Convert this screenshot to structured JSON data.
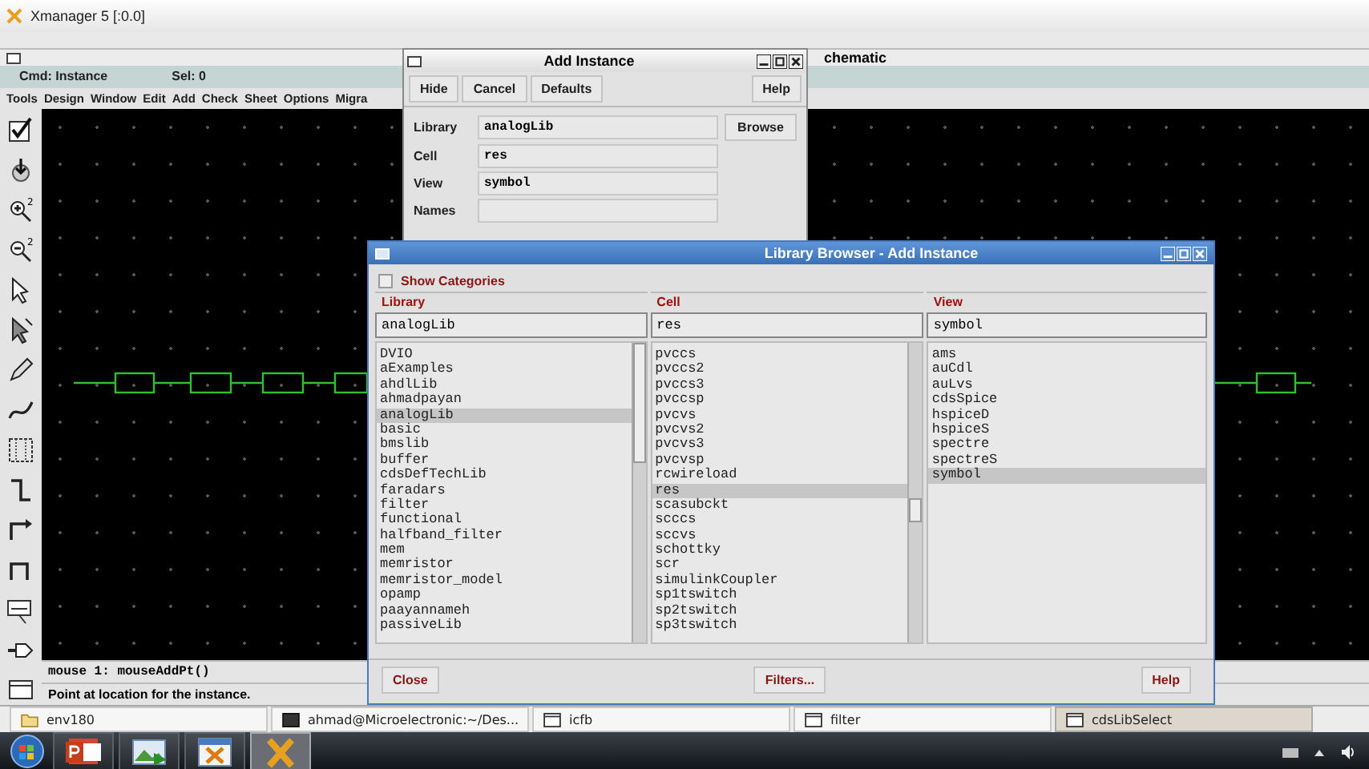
{
  "app_window": {
    "title": "Xmanager 5 [:0.0]"
  },
  "schematic": {
    "title": "chematic",
    "command": "Cmd: Instance",
    "selection": "Sel: 0",
    "menu": [
      "Tools",
      "Design",
      "Window",
      "Edit",
      "Add",
      "Check",
      "Sheet",
      "Options",
      "Migra"
    ],
    "messages": [
      "mouse 1: mouseAddPt()",
      "Point at location for the instance."
    ]
  },
  "add_instance": {
    "title": "Add Instance",
    "buttons": [
      "Hide",
      "Cancel",
      "Defaults",
      "Help"
    ],
    "fields": [
      {
        "label": "Library",
        "value": "analogLib"
      },
      {
        "label": "Cell",
        "value": "res"
      },
      {
        "label": "View",
        "value": "symbol"
      },
      {
        "label": "Names"
      }
    ],
    "browse": "Browse"
  },
  "library_browser": {
    "title": "Library Browser - Add Instance",
    "show_categories": {
      "label": "Show Categories",
      "checked": false
    },
    "columns": [
      {
        "heading": "Library",
        "value": "analogLib",
        "items": [
          {
            "label": "DVIO",
            "selected": false
          },
          {
            "label": "aExamples",
            "selected": false
          },
          {
            "label": "ahdlLib",
            "selected": false
          },
          {
            "label": "ahmadpayan",
            "selected": false
          },
          {
            "label": "analogLib",
            "selected": true
          },
          {
            "label": "basic",
            "selected": false
          },
          {
            "label": "bmslib",
            "selected": false
          },
          {
            "label": "buffer",
            "selected": false
          },
          {
            "label": "cdsDefTechLib",
            "selected": false
          },
          {
            "label": "faradars",
            "selected": false
          },
          {
            "label": "filter",
            "selected": false
          },
          {
            "label": "functional",
            "selected": false
          },
          {
            "label": "halfband_filter",
            "selected": false
          },
          {
            "label": "mem",
            "selected": false
          },
          {
            "label": "memristor",
            "selected": false
          },
          {
            "label": "memristor_model",
            "selected": false
          },
          {
            "label": "opamp",
            "selected": false
          },
          {
            "label": "paayannameh",
            "selected": false
          },
          {
            "label": "passiveLib",
            "selected": false
          }
        ]
      },
      {
        "heading": "Cell",
        "value": "res",
        "items": [
          {
            "label": "pvccs",
            "selected": false
          },
          {
            "label": "pvccs2",
            "selected": false
          },
          {
            "label": "pvccs3",
            "selected": false
          },
          {
            "label": "pvccsp",
            "selected": false
          },
          {
            "label": "pvcvs",
            "selected": false
          },
          {
            "label": "pvcvs2",
            "selected": false
          },
          {
            "label": "pvcvs3",
            "selected": false
          },
          {
            "label": "pvcvsp",
            "selected": false
          },
          {
            "label": "rcwireload",
            "selected": false
          },
          {
            "label": "res",
            "selected": true
          },
          {
            "label": "scasubckt",
            "selected": false
          },
          {
            "label": "scccs",
            "selected": false
          },
          {
            "label": "sccvs",
            "selected": false
          },
          {
            "label": "schottky",
            "selected": false
          },
          {
            "label": "scr",
            "selected": false
          },
          {
            "label": "simulinkCoupler",
            "selected": false
          },
          {
            "label": "sp1tswitch",
            "selected": false
          },
          {
            "label": "sp2tswitch",
            "selected": false
          },
          {
            "label": "sp3tswitch",
            "selected": false
          }
        ]
      },
      {
        "heading": "View",
        "value": "symbol",
        "items": [
          {
            "label": "ams",
            "selected": false
          },
          {
            "label": "auCdl",
            "selected": false
          },
          {
            "label": "auLvs",
            "selected": false
          },
          {
            "label": "cdsSpice",
            "selected": false
          },
          {
            "label": "hspiceD",
            "selected": false
          },
          {
            "label": "hspiceS",
            "selected": false
          },
          {
            "label": "spectre",
            "selected": false
          },
          {
            "label": "spectreS",
            "selected": false
          },
          {
            "label": "symbol",
            "selected": true
          }
        ]
      }
    ],
    "buttons": [
      "Close",
      "Filters...",
      "Help"
    ]
  },
  "tasks": [
    {
      "label": "env180",
      "kind": "folder",
      "selected": false
    },
    {
      "label": "ahmad@Microelectronic:~/Des...",
      "kind": "terminal",
      "selected": false
    },
    {
      "label": "icfb",
      "kind": "window",
      "selected": false
    },
    {
      "label": "filter",
      "kind": "window",
      "selected": false
    },
    {
      "label": "cdsLibSelect",
      "kind": "window",
      "selected": true
    }
  ],
  "toolbar": [
    {
      "kind": "check"
    },
    {
      "kind": "down"
    },
    {
      "kind": "zoomin",
      "badge": "2"
    },
    {
      "kind": "zoomout",
      "badge": "2"
    },
    {
      "kind": "pointer"
    },
    {
      "kind": "pointer2"
    },
    {
      "kind": "pencil"
    },
    {
      "kind": "wire"
    },
    {
      "kind": "grid"
    },
    {
      "kind": "stair"
    },
    {
      "kind": "bend"
    },
    {
      "kind": "bend2"
    },
    {
      "kind": "label"
    },
    {
      "kind": "pin"
    },
    {
      "kind": "rect"
    }
  ],
  "taskbar": {
    "apps": [
      {
        "kind": "presentation",
        "selected": false
      },
      {
        "kind": "image",
        "selected": false
      },
      {
        "kind": "xwindow",
        "selected": false
      },
      {
        "kind": "xlogo",
        "selected": true
      }
    ]
  }
}
